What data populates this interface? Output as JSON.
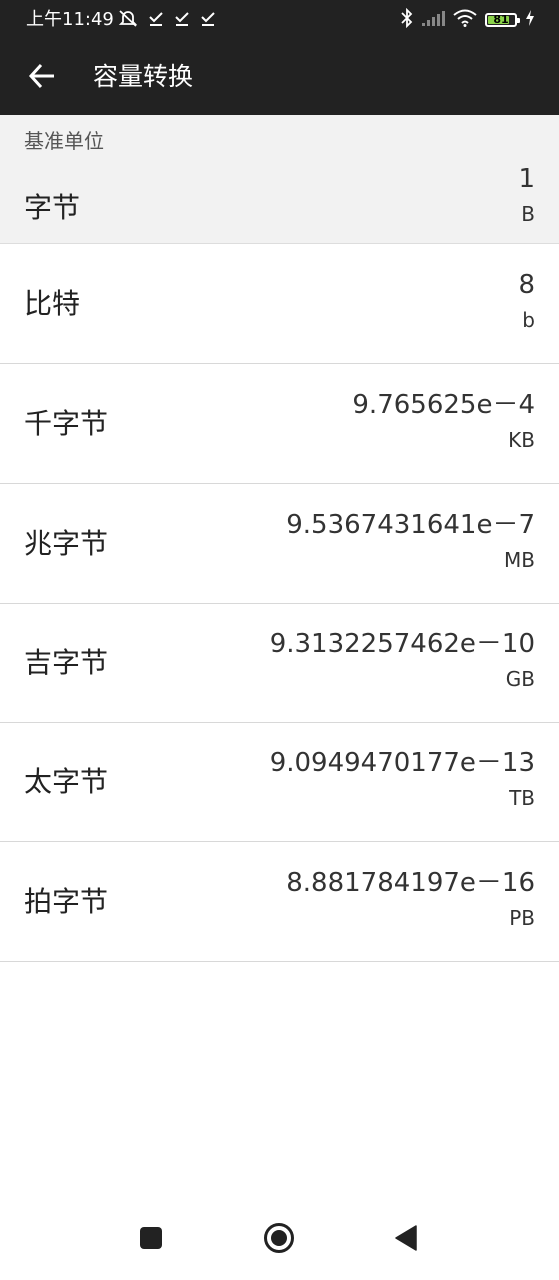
{
  "status_bar": {
    "time": "上午11:49",
    "battery_level": "81",
    "battery_fraction": 0.81,
    "left_icons": [
      "alarm-off-icon",
      "checkbox-icon",
      "checkbox-icon",
      "checkbox-icon"
    ],
    "right_icons": [
      "bluetooth-icon",
      "signal-icon",
      "wifi-icon",
      "battery-icon",
      "charging-icon"
    ]
  },
  "app_bar": {
    "back_icon": "arrow-left-icon",
    "title": "容量转换"
  },
  "base_unit": {
    "header": "基准单位",
    "name": "字节",
    "value": "1",
    "unit": "B"
  },
  "conversions": [
    {
      "name": "比特",
      "value": "8",
      "unit": "b"
    },
    {
      "name": "千字节",
      "value": "9.765625e－4",
      "unit": "KB"
    },
    {
      "name": "兆字节",
      "value": "9.5367431641e－7",
      "unit": "MB"
    },
    {
      "name": "吉字节",
      "value": "9.3132257462e－10",
      "unit": "GB"
    },
    {
      "name": "太字节",
      "value": "9.0949470177e－13",
      "unit": "TB"
    },
    {
      "name": "拍字节",
      "value": "8.881784197e－16",
      "unit": "PB"
    }
  ],
  "nav_bar": {
    "icons": [
      "recents-square-icon",
      "home-circle-icon",
      "back-triangle-icon"
    ]
  },
  "colors": {
    "bar_background": "#222222",
    "base_row_background": "#f2f2f2",
    "battery_fill": "#8bd34a"
  }
}
